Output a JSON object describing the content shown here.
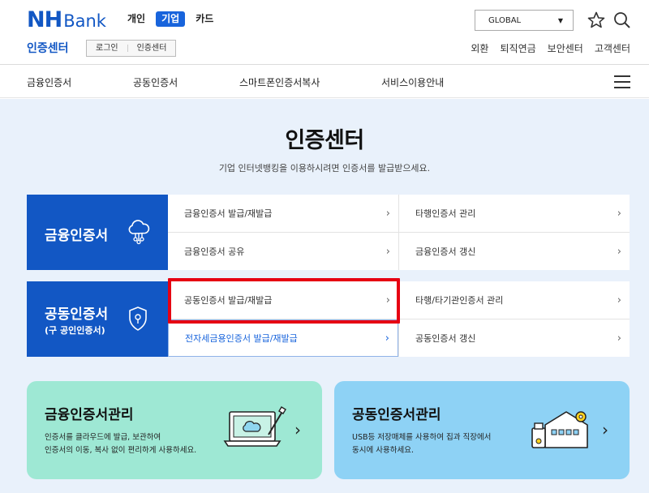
{
  "header": {
    "logo_nh": "NH",
    "logo_bank": "Bank",
    "main_tabs": [
      "개인",
      "기업",
      "카드"
    ],
    "active_tab": "기업",
    "section_title": "인증센터",
    "breadcrumb": [
      "로그인",
      "인증센터"
    ],
    "global_select": "GLOBAL",
    "top_links": [
      "외환",
      "퇴직연금",
      "보안센터",
      "고객센터"
    ]
  },
  "nav": {
    "items": [
      "금융인증서",
      "공동인증서",
      "스마트폰인증서복사",
      "서비스이용안내"
    ]
  },
  "page": {
    "title": "인증센터",
    "description": "기업 인터넷뱅킹을 이용하시려면 인증서를 발급받으세요."
  },
  "financial_block": {
    "title": "금융인증서",
    "links": [
      "금융인증서 발급/재발급",
      "타행인증서 관리",
      "금융인증서 공유",
      "금융인증서 갱신"
    ]
  },
  "joint_block": {
    "title": "공동인증서",
    "subtitle": "(구 공인인증서)",
    "links": [
      "공동인증서 발급/재발급",
      "타행/타기관인증서 관리",
      "전자세금용인증서 발급/재발급",
      "공동인증서 갱신"
    ]
  },
  "cards": [
    {
      "title": "금융인증서관리",
      "line1": "인증서를 클라우드에 발급, 보관하여",
      "line2": "인증서의 이동, 복사 없이 편리하게 사용하세요.",
      "bg": "#9ee8d4"
    },
    {
      "title": "공동인증서관리",
      "line1": "USB등 저장매체를 사용하여 집과 직장에서",
      "line2": "동시에 사용하세요.",
      "bg": "#8ed2f5"
    }
  ],
  "colors": {
    "brand": "#1257c4",
    "active_tab": "#1864dc",
    "highlight_box": "#e60012",
    "page_bg": "#e9f1fb"
  },
  "icons": {
    "search": "search-icon",
    "star": "star-icon",
    "cloud": "cloud-icon",
    "shield": "shield-icon",
    "menu": "hamburger-menu-icon"
  }
}
